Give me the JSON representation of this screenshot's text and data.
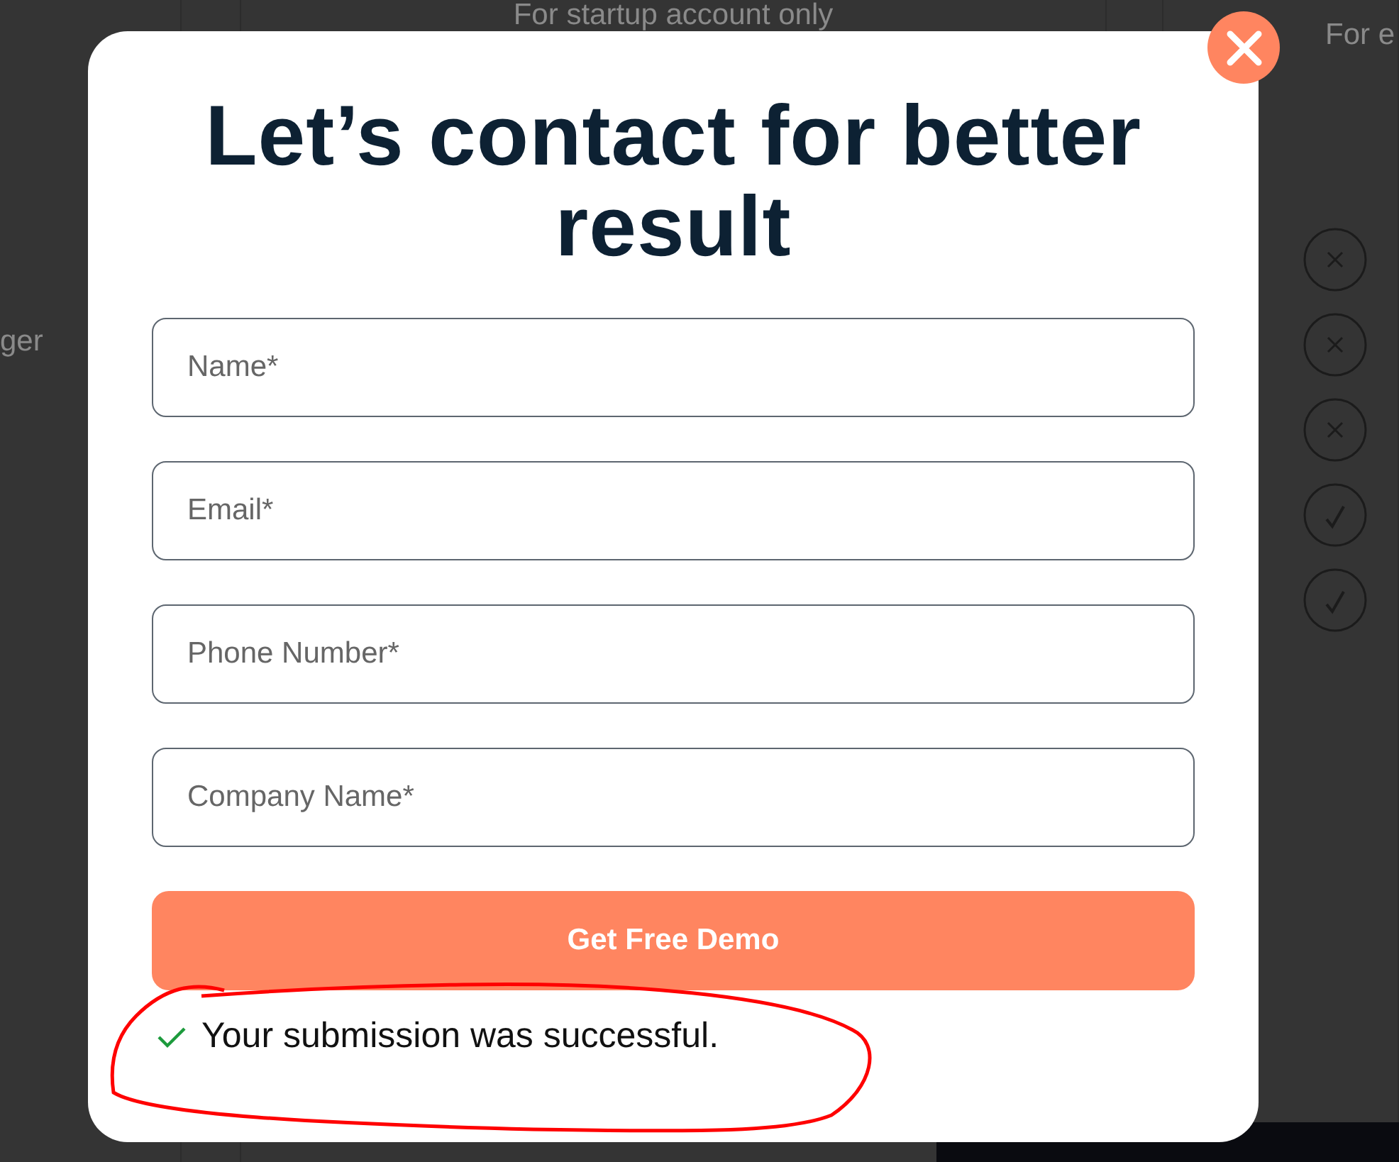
{
  "background": {
    "left_text": "ger",
    "center_text": "For startup account only",
    "right_text": "For e",
    "features": [
      {
        "included": false
      },
      {
        "included": false
      },
      {
        "included": false
      },
      {
        "included": true
      },
      {
        "included": true
      }
    ]
  },
  "modal": {
    "title": "Let’s contact for better result",
    "fields": [
      {
        "placeholder": "Name*"
      },
      {
        "placeholder": "Email*"
      },
      {
        "placeholder": "Phone Number*"
      },
      {
        "placeholder": "Company Name*"
      }
    ],
    "submit": "Get Free Demo",
    "success_message": "Your submission was successful."
  }
}
